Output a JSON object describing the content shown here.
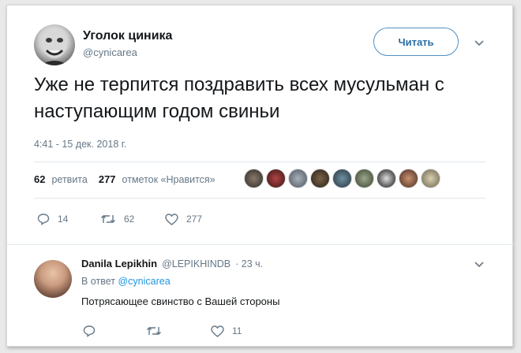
{
  "tweet": {
    "author_name": "Уголок циника",
    "author_handle": "@cynicarea",
    "follow_label": "Читать",
    "text": "Уже не терпится поздравить всех мусульман с наступающим годом свиньи",
    "date": "4:41 - 15 дек. 2018 г.",
    "retweets_count": "62",
    "retweets_label": "ретвита",
    "likes_count": "277",
    "likes_label": "отметок «Нравится»",
    "reply_action_count": "14",
    "retweet_action_count": "62",
    "like_action_count": "277"
  },
  "reply": {
    "author_name": "Danila Lepikhin",
    "author_handle": "@LEPIKHINDB",
    "time": "· 23 ч.",
    "in_reply_prefix": "В ответ",
    "in_reply_handle": "@cynicarea",
    "text": "Потрясающее свинство с Вашей стороны",
    "like_count": "11"
  },
  "icons": [
    "chevron-down-icon",
    "reply-icon",
    "retweet-icon",
    "heart-icon"
  ],
  "colors": {
    "accent": "#1b95e0",
    "follow_border": "#4f90c4",
    "muted": "#657786",
    "divider": "#e1e8ed"
  }
}
